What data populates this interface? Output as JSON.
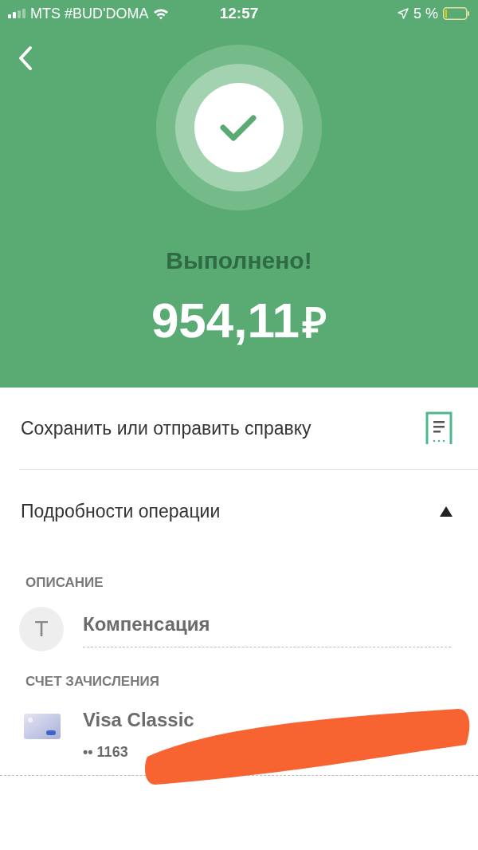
{
  "status_bar": {
    "carrier": "MTS #BUD'DOMA",
    "time": "12:57",
    "battery": "5 %"
  },
  "result": {
    "title": "Выполнено!",
    "amount": "954,11",
    "currency": "₽"
  },
  "receipt": {
    "label": "Сохранить или отправить справку"
  },
  "details": {
    "title": "Подробности операции",
    "expanded": true,
    "sections": [
      {
        "kind": "description",
        "heading": "ОПИСАНИЕ",
        "avatar": "Т",
        "value": "Компенсация"
      },
      {
        "kind": "account",
        "heading": "СЧЕТ ЗАЧИСЛЕНИЯ",
        "name": "Visa Classic",
        "number": "•• 1163",
        "redacted": true
      }
    ]
  }
}
